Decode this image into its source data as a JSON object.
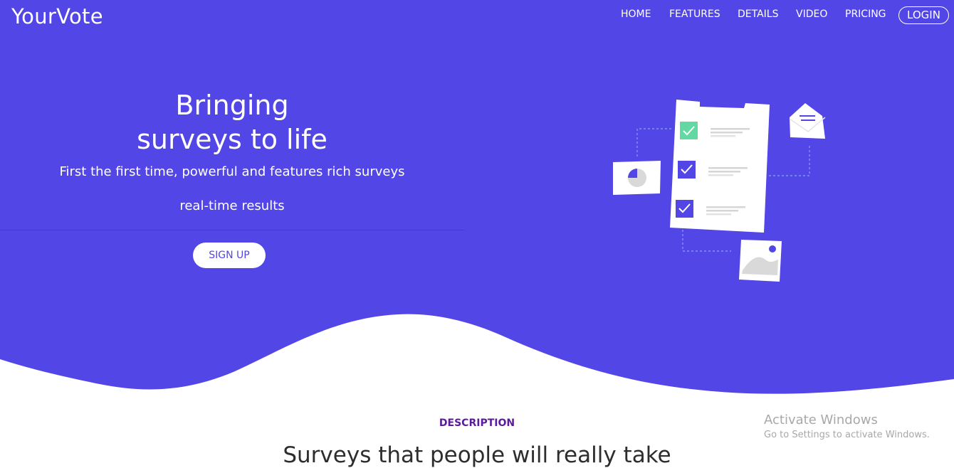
{
  "colors": {
    "hero_bg": "#5246e6",
    "text_on_hero": "#ffffff",
    "accent_purple": "#5b1a9e",
    "check_green": "#62d9a2"
  },
  "navbar": {
    "brand": "YourVote",
    "links": [
      "HOME",
      "FEATURES",
      "DETAILS",
      "VIDEO",
      "PRICING"
    ],
    "login_label": "LOGIN"
  },
  "hero": {
    "title_line1": "Bringing",
    "title_line2": "surveys to life",
    "subtitle_line1": "First the first time, powerful and features rich surveys",
    "subtitle_line2": "real-time results",
    "cta_label": "SIGN UP",
    "illustration_icons": [
      "checklist-document-icon",
      "envelope-icon",
      "pie-chart-card-icon",
      "image-card-icon",
      "checkbox-icon"
    ]
  },
  "description": {
    "label": "DESCRIPTION",
    "heading": "Surveys that people will really take"
  },
  "windows_watermark": {
    "title": "Activate Windows",
    "subtitle": "Go to Settings to activate Windows."
  }
}
